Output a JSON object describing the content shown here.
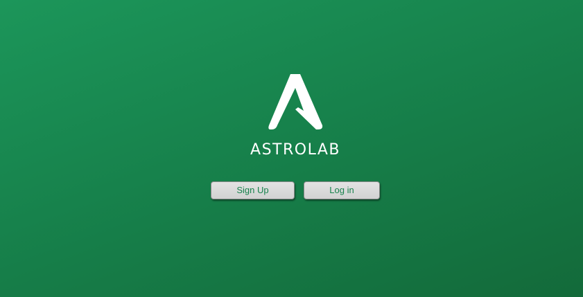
{
  "app": {
    "logo_icon": "astrolab-a-logo-icon",
    "brand_name": "ASTROLAB",
    "background_color": "#17824c"
  },
  "actions": {
    "signup_label": "Sign Up",
    "login_label": "Log in",
    "button_text_color": "#17824c"
  }
}
